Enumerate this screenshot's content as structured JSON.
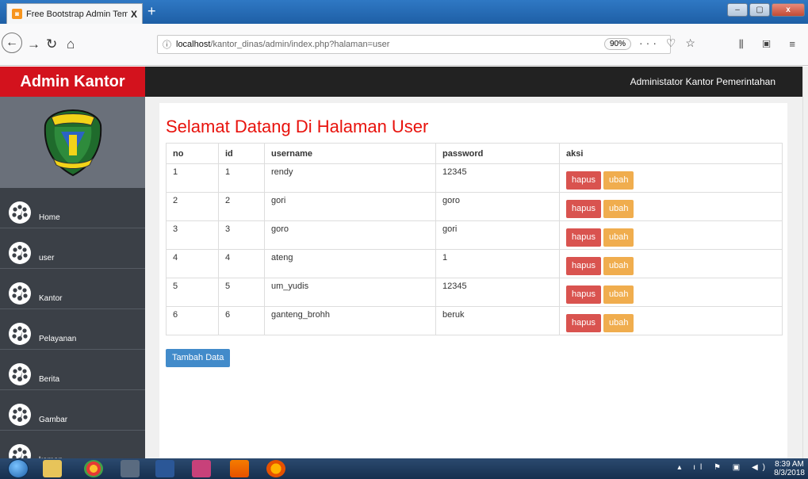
{
  "browser": {
    "tab_title": "Free Bootstrap Admin Templat",
    "tab_close": "X",
    "new_tab": "+",
    "url_host": "localhost",
    "url_path": "/kantor_dinas/admin/index.php?halaman=user",
    "zoom": "90%",
    "url_actions": "··· ♡ ☆",
    "right_icons": "⫼ ▣ ≡"
  },
  "header": {
    "brand": "Admin Kantor",
    "user_text": "Administator Kantor Pemerintahan"
  },
  "sidebar": {
    "items": [
      {
        "label": "Home"
      },
      {
        "label": "user"
      },
      {
        "label": "Kantor"
      },
      {
        "label": "Pelayanan"
      },
      {
        "label": "Berita"
      },
      {
        "label": "Gambar"
      },
      {
        "label": "komen"
      }
    ]
  },
  "main": {
    "title": "Selamat Datang Di Halaman User",
    "columns": [
      "no",
      "id",
      "username",
      "password",
      "aksi"
    ],
    "rows": [
      {
        "no": "1",
        "id": "1",
        "username": "rendy",
        "password": "12345"
      },
      {
        "no": "2",
        "id": "2",
        "username": "gori",
        "password": "goro"
      },
      {
        "no": "3",
        "id": "3",
        "username": "goro",
        "password": "gori"
      },
      {
        "no": "4",
        "id": "4",
        "username": "ateng",
        "password": "1"
      },
      {
        "no": "5",
        "id": "5",
        "username": "um_yudis",
        "password": "12345"
      },
      {
        "no": "6",
        "id": "6",
        "username": "ganteng_brohh",
        "password": "beruk"
      }
    ],
    "delete_label": "hapus",
    "edit_label": "ubah",
    "add_label": "Tambah Data"
  },
  "taskbar": {
    "time": "8:39 AM",
    "date": "8/3/2018"
  },
  "colors": {
    "brand_red": "#d3121d",
    "title_red": "#e8120c",
    "danger": "#d9534f",
    "warning": "#f0ad4e",
    "primary": "#428bca",
    "sidebar": "#3b4047"
  },
  "icons": [
    "dashboard-icon",
    "crest-logo",
    "back-icon",
    "forward-icon",
    "reload-icon",
    "home-icon",
    "info-icon"
  ]
}
